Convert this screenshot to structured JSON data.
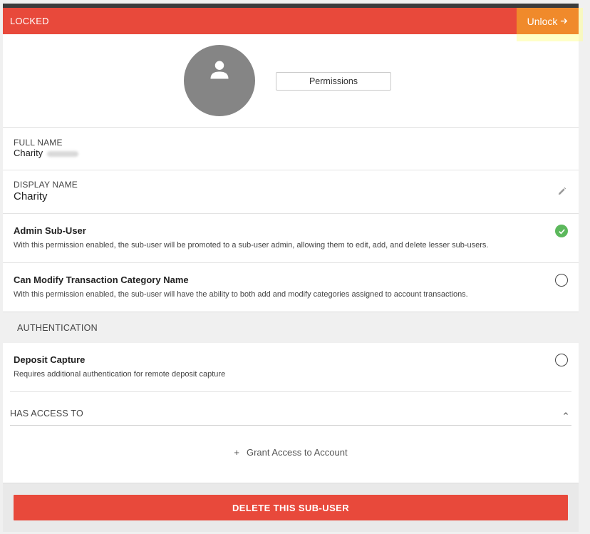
{
  "banner": {
    "status": "LOCKED",
    "unlock_label": "Unlock",
    "bg_color": "#e8493b",
    "unlock_color": "#f08a2b"
  },
  "profile": {
    "avatar_icon": "user-icon",
    "permissions_button": "Permissions"
  },
  "fields": {
    "full_name_label": "FULL NAME",
    "full_name_value": "Charity",
    "display_name_label": "DISPLAY NAME",
    "display_name_value": "Charity"
  },
  "permissions": [
    {
      "title": "Admin Sub-User",
      "description": "With this permission enabled, the sub-user will be promoted to a sub-user admin, allowing them to edit, add, and delete lesser sub-users.",
      "enabled": true
    },
    {
      "title": "Can Modify Transaction Category Name",
      "description": "With this permission enabled, the sub-user will have the ability to both add and modify categories assigned to account transactions.",
      "enabled": false
    }
  ],
  "authentication": {
    "section_label": "AUTHENTICATION",
    "items": [
      {
        "title": "Deposit Capture",
        "description": "Requires additional authentication for remote deposit capture",
        "enabled": false
      }
    ]
  },
  "access": {
    "section_label": "HAS ACCESS TO",
    "grant_plus": "+",
    "grant_label": "Grant Access to Account"
  },
  "footer": {
    "delete_label": "DELETE THIS SUB-USER"
  }
}
